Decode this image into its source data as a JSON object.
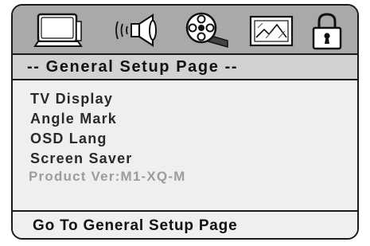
{
  "tabs": [
    {
      "icon": "tv-icon"
    },
    {
      "icon": "speaker-icon"
    },
    {
      "icon": "film-reel-icon"
    },
    {
      "icon": "picture-icon"
    },
    {
      "icon": "padlock-icon"
    }
  ],
  "page_title": "-- General Setup Page --",
  "menu": {
    "items": [
      "TV Display",
      "Angle Mark",
      "OSD Lang",
      "Screen Saver"
    ],
    "version": "Product Ver:M1-XQ-M"
  },
  "status": "Go To General Setup Page",
  "colors": {
    "icon_bar": "#a9a9a9",
    "title_bar": "#d2d2d2",
    "menu_bg": "#efefef",
    "version_text": "#9c9c9c"
  }
}
